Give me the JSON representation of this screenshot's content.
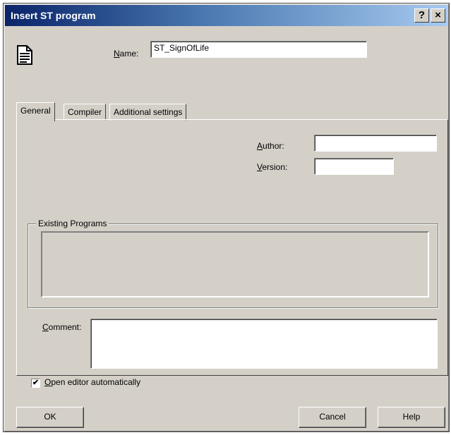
{
  "window": {
    "title": "Insert ST program",
    "help_glyph": "?",
    "close_glyph": "×"
  },
  "name": {
    "accel": "N",
    "rest": "ame:",
    "value": "ST_SignOfLife"
  },
  "tabs": [
    {
      "label": "General"
    },
    {
      "label": "Compiler"
    },
    {
      "label": "Additional settings"
    }
  ],
  "general": {
    "author_accel": "A",
    "author_rest": "uthor:",
    "author_value": "",
    "version_accel": "V",
    "version_rest": "ersion:",
    "version_value": "",
    "existing_programs_title": "Existing Programs",
    "comment_accel": "C",
    "comment_rest": "omment:",
    "comment_value": "",
    "open_editor_accel": "O",
    "open_editor_rest": "pen editor automatically",
    "open_editor_checked": true,
    "check_glyph": "✔"
  },
  "buttons": {
    "ok": "OK",
    "cancel": "Cancel",
    "help": "Help"
  },
  "icons": {
    "document": "document-icon",
    "help": "help-icon",
    "close": "close-icon",
    "checkbox": "checkbox-icon"
  }
}
